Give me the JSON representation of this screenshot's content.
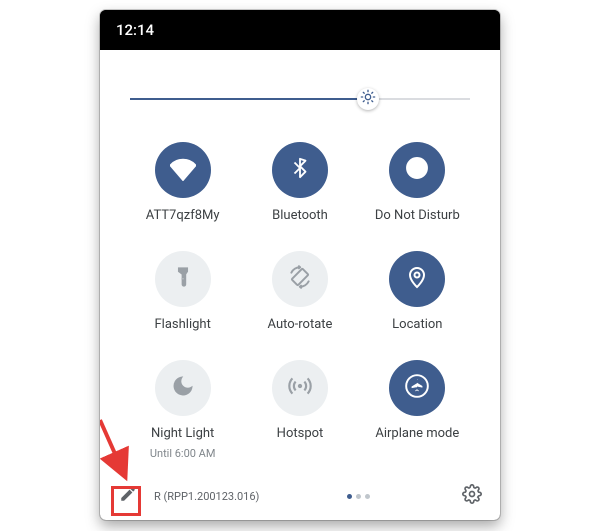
{
  "status": {
    "time": "12:14"
  },
  "brightness": {
    "percent": 70
  },
  "tiles": [
    {
      "id": "wifi",
      "label": "ATT7qzf8My",
      "active": true
    },
    {
      "id": "bluetooth",
      "label": "Bluetooth",
      "active": true
    },
    {
      "id": "dnd",
      "label": "Do Not Disturb",
      "active": true
    },
    {
      "id": "flashlight",
      "label": "Flashlight",
      "active": false
    },
    {
      "id": "autorotate",
      "label": "Auto-rotate",
      "active": false
    },
    {
      "id": "location",
      "label": "Location",
      "active": true
    },
    {
      "id": "nightlight",
      "label": "Night Light",
      "sublabel": "Until 6:00 AM",
      "active": false
    },
    {
      "id": "hotspot",
      "label": "Hotspot",
      "active": false
    },
    {
      "id": "airplane",
      "label": "Airplane mode",
      "active": true
    }
  ],
  "footer": {
    "build_text": "R (RPP1.200123.016)"
  }
}
